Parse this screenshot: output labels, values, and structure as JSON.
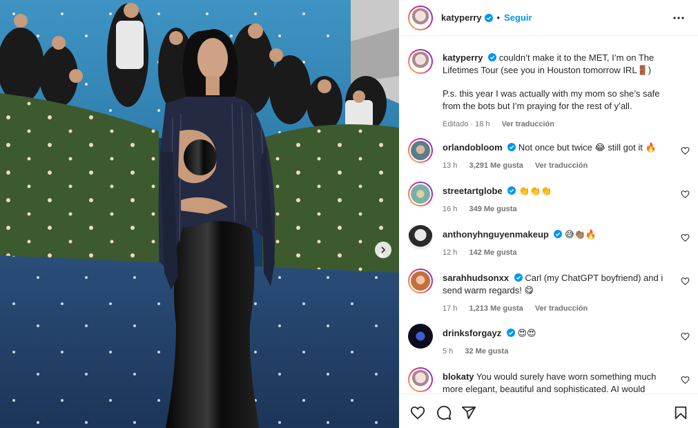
{
  "post": {
    "username": "katyperry",
    "separator": "•",
    "follow_label": "Seguir",
    "caption_user": "katyperry",
    "caption_text": "couldn’t make it to the MET, I’m on The Lifetimes Tour (see you in Houston tomorrow IRL🚪)",
    "caption_ps": "P.s. this year I was actually with my mom so she’s safe from the bots but I’m praying for the rest of y’all.",
    "caption_meta": "Editado · 18 h",
    "caption_translate": "Ver traducción"
  },
  "comments": [
    {
      "user": "orlandobloom",
      "verified": true,
      "text": "Not once but twice 😂 still got it 🔥",
      "time": "13 h",
      "likes": "3,291 Me gusta",
      "translate": "Ver traducción"
    },
    {
      "user": "streetartglobe",
      "verified": true,
      "text": "👏👏👏",
      "time": "16 h",
      "likes": "349 Me gusta",
      "translate": ""
    },
    {
      "user": "anthonyhnguyenmakeup",
      "verified": true,
      "text": "😅👏🏽🔥",
      "time": "12 h",
      "likes": "142 Me gusta",
      "translate": ""
    },
    {
      "user": "sarahhudsonxx",
      "verified": true,
      "text": "Carl (my ChatGPT boyfriend) and i send warm regards! 😋",
      "time": "17 h",
      "likes": "1,213 Me gusta",
      "translate": "Ver traducción"
    },
    {
      "user": "drinksforgayz",
      "verified": true,
      "text": "😍😍",
      "time": "5 h",
      "likes": "32 Me gusta",
      "translate": ""
    },
    {
      "user": "blokaty",
      "verified": false,
      "text": "You would surely have worn something much more elegant, beautiful and sophisticated. AI would",
      "time": "",
      "likes": "",
      "translate": ""
    }
  ],
  "colors": {
    "accent": "#0095f6",
    "verified": "#0095f6",
    "muted": "#737373",
    "carpet": "#1e3f6b",
    "backdrop": "#3c8fc0"
  },
  "icons": [
    "verified-badge-icon",
    "more-options-icon",
    "heart-icon",
    "comment-icon",
    "share-icon",
    "bookmark-icon",
    "chevron-right-icon"
  ]
}
